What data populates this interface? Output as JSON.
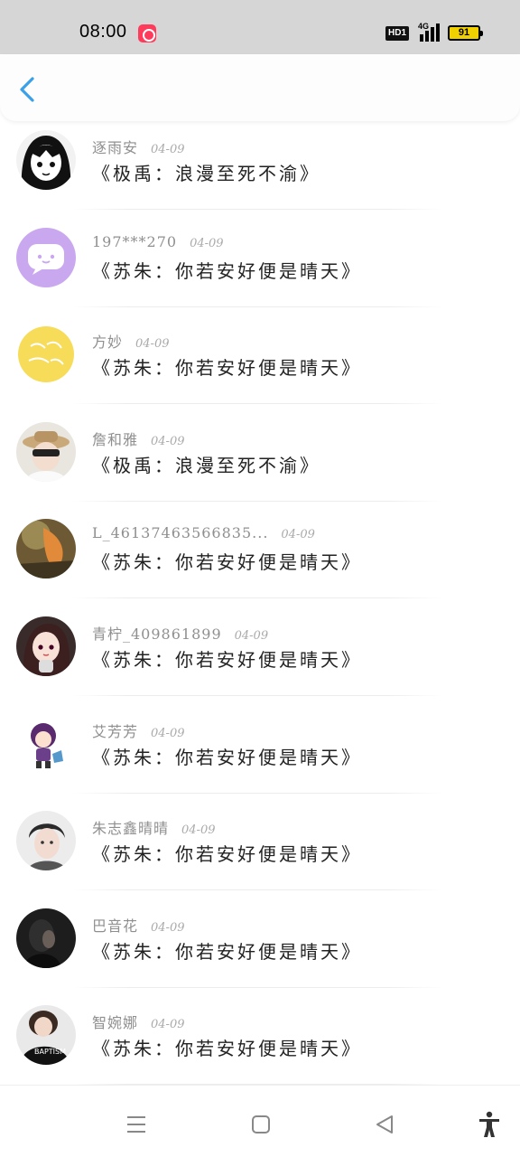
{
  "status_bar": {
    "time": "08:00",
    "hd_label": "HD1",
    "network_label": "4G",
    "battery_level": "91"
  },
  "header": {
    "back_icon": "chevron-left-icon",
    "accent_color": "#3aa0e8"
  },
  "list": {
    "items": [
      {
        "name": "逐雨安",
        "date": "04-09",
        "title": "《极禹：浪漫至死不渝》",
        "avatar": "anime-girl"
      },
      {
        "name": "197***270",
        "date": "04-09",
        "title": "《苏朱：你若安好便是晴天》",
        "avatar": "chat-bubble"
      },
      {
        "name": "方妙",
        "date": "04-09",
        "title": "《苏朱：你若安好便是晴天》",
        "avatar": "yellow-circle"
      },
      {
        "name": "詹和雅",
        "date": "04-09",
        "title": "《极禹：浪漫至死不渝》",
        "avatar": "hat-person"
      },
      {
        "name": "L_46137463566835...",
        "date": "04-09",
        "title": "《苏朱：你若安好便是晴天》",
        "avatar": "autumn-leaves"
      },
      {
        "name": "青柠_409861899",
        "date": "04-09",
        "title": "《苏朱：你若安好便是晴天》",
        "avatar": "cartoon-girl"
      },
      {
        "name": "艾芳芳",
        "date": "04-09",
        "title": "《苏朱：你若安好便是晴天》",
        "avatar": "chibi-character"
      },
      {
        "name": "朱志鑫晴晴",
        "date": "04-09",
        "title": "《苏朱：你若安好便是晴天》",
        "avatar": "boy-portrait"
      },
      {
        "name": "巴音花",
        "date": "04-09",
        "title": "《苏朱：你若安好便是晴天》",
        "avatar": "dark-silhouette"
      },
      {
        "name": "智婉娜",
        "date": "04-09",
        "title": "《苏朱：你若安好便是晴天》",
        "avatar": "black-shirt"
      }
    ]
  },
  "bottom_nav": {
    "menu_icon": "menu-icon",
    "home_icon": "square-home-icon",
    "back_icon": "triangle-back-icon",
    "accessibility_icon": "accessibility-icon"
  }
}
